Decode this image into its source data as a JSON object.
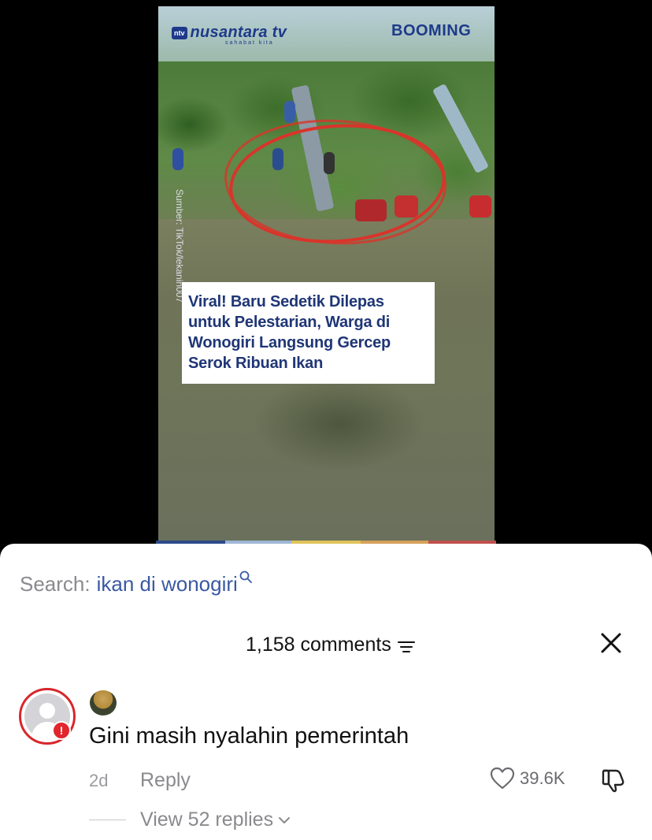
{
  "video": {
    "channel_badge": "ntv",
    "channel_name": "nusantara tv",
    "channel_tagline": "sahabat kita",
    "brand_right": "BOOMING",
    "source_credit": "Sumber: TikTok/lekanin007",
    "headline_lines": [
      "Viral! Baru Sedetik Dilepas",
      "untuk Pelestarian, Warga di",
      "Wonogiri Langsung Gercep",
      "Serok Ribuan Ikan"
    ],
    "progress_colors": [
      "#2d4a8a",
      "#9fb7d6",
      "#e0c35a",
      "#d5a15a",
      "#c0504d"
    ]
  },
  "search": {
    "label": "Search:",
    "query": "ikan di wonogiri",
    "icon": "search-icon"
  },
  "comments_header": {
    "count_label": "1,158 comments",
    "sort_icon": "filter-lines-icon",
    "close_icon": "close-icon"
  },
  "comment": {
    "text": "Gini masih nyalahin pemerintah",
    "time": "2d",
    "reply_label": "Reply",
    "likes": "39.6K",
    "view_replies_label": "View 52 replies",
    "colors": {
      "alert": "#e1262d"
    }
  }
}
